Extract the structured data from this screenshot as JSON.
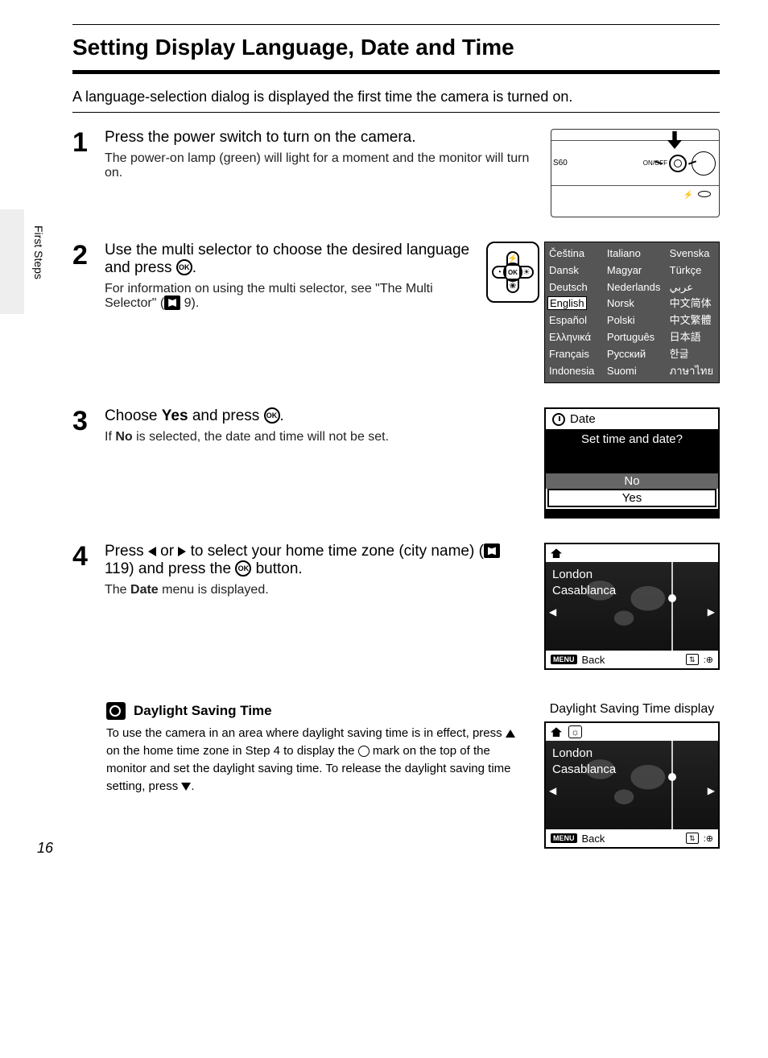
{
  "side_label": "First Steps",
  "page_number": "16",
  "title": "Setting Display Language, Date and Time",
  "intro": "A language-selection dialog is displayed the first time the camera is turned on.",
  "step1": {
    "num": "1",
    "heading": "Press the power switch to turn on the camera.",
    "body": "The power-on lamp (green) will light for a moment and the monitor will turn on.",
    "cam": {
      "model": "S60",
      "switch": "ON/OFF"
    }
  },
  "step2": {
    "num": "2",
    "heading_pre": "Use the multi selector to choose the desired language and press ",
    "heading_ok": "OK",
    "heading_post": ".",
    "body_pre": "For information on using the multi selector, see \"The Multi Selector\" (",
    "body_ref": " 9).",
    "selector_center": "OK",
    "lang": {
      "col1": [
        "Čeština",
        "Dansk",
        "Deutsch",
        "English",
        "Español",
        "Ελληνικά",
        "Français",
        "Indonesia"
      ],
      "col2": [
        "Italiano",
        "Magyar",
        "Nederlands",
        "Norsk",
        "Polski",
        "Português",
        "Русский",
        "Suomi"
      ],
      "col3": [
        "Svenska",
        "Türkçe",
        "عربي",
        "中文简体",
        "中文繁體",
        "日本語",
        "한글",
        "ภาษาไทย"
      ],
      "selected": "English"
    }
  },
  "step3": {
    "num": "3",
    "heading_pre": "Choose ",
    "heading_bold": "Yes",
    "heading_mid": " and press ",
    "heading_ok": "OK",
    "heading_post": ".",
    "body_pre": "If ",
    "body_bold": "No",
    "body_post": " is selected, the date and time will not be set.",
    "dialog": {
      "title": "Date",
      "question": "Set time and date?",
      "no": "No",
      "yes": "Yes"
    }
  },
  "step4": {
    "num": "4",
    "heading_pre": "Press ",
    "heading_mid1": " or ",
    "heading_mid2": " to select your home time zone (city name) (",
    "heading_ref": " 119) and press the ",
    "heading_ok": "OK",
    "heading_post": " button.",
    "body_pre": "The ",
    "body_bold": "Date",
    "body_post": " menu is displayed.",
    "tz": {
      "city1": "London",
      "city2": "Casablanca",
      "menu": "MENU",
      "back": "Back"
    }
  },
  "note": {
    "title": "Daylight Saving Time",
    "body_1": "To use the camera in an area where daylight saving time is in effect, press ",
    "body_2": " on the home time zone in Step 4 to display the ",
    "body_3": " mark on the top of the monitor and set the daylight saving time. To release the daylight saving time setting, press ",
    "body_4": ".",
    "caption": "Daylight Saving Time display",
    "tz": {
      "city1": "London",
      "city2": "Casablanca",
      "menu": "MENU",
      "back": "Back"
    }
  }
}
